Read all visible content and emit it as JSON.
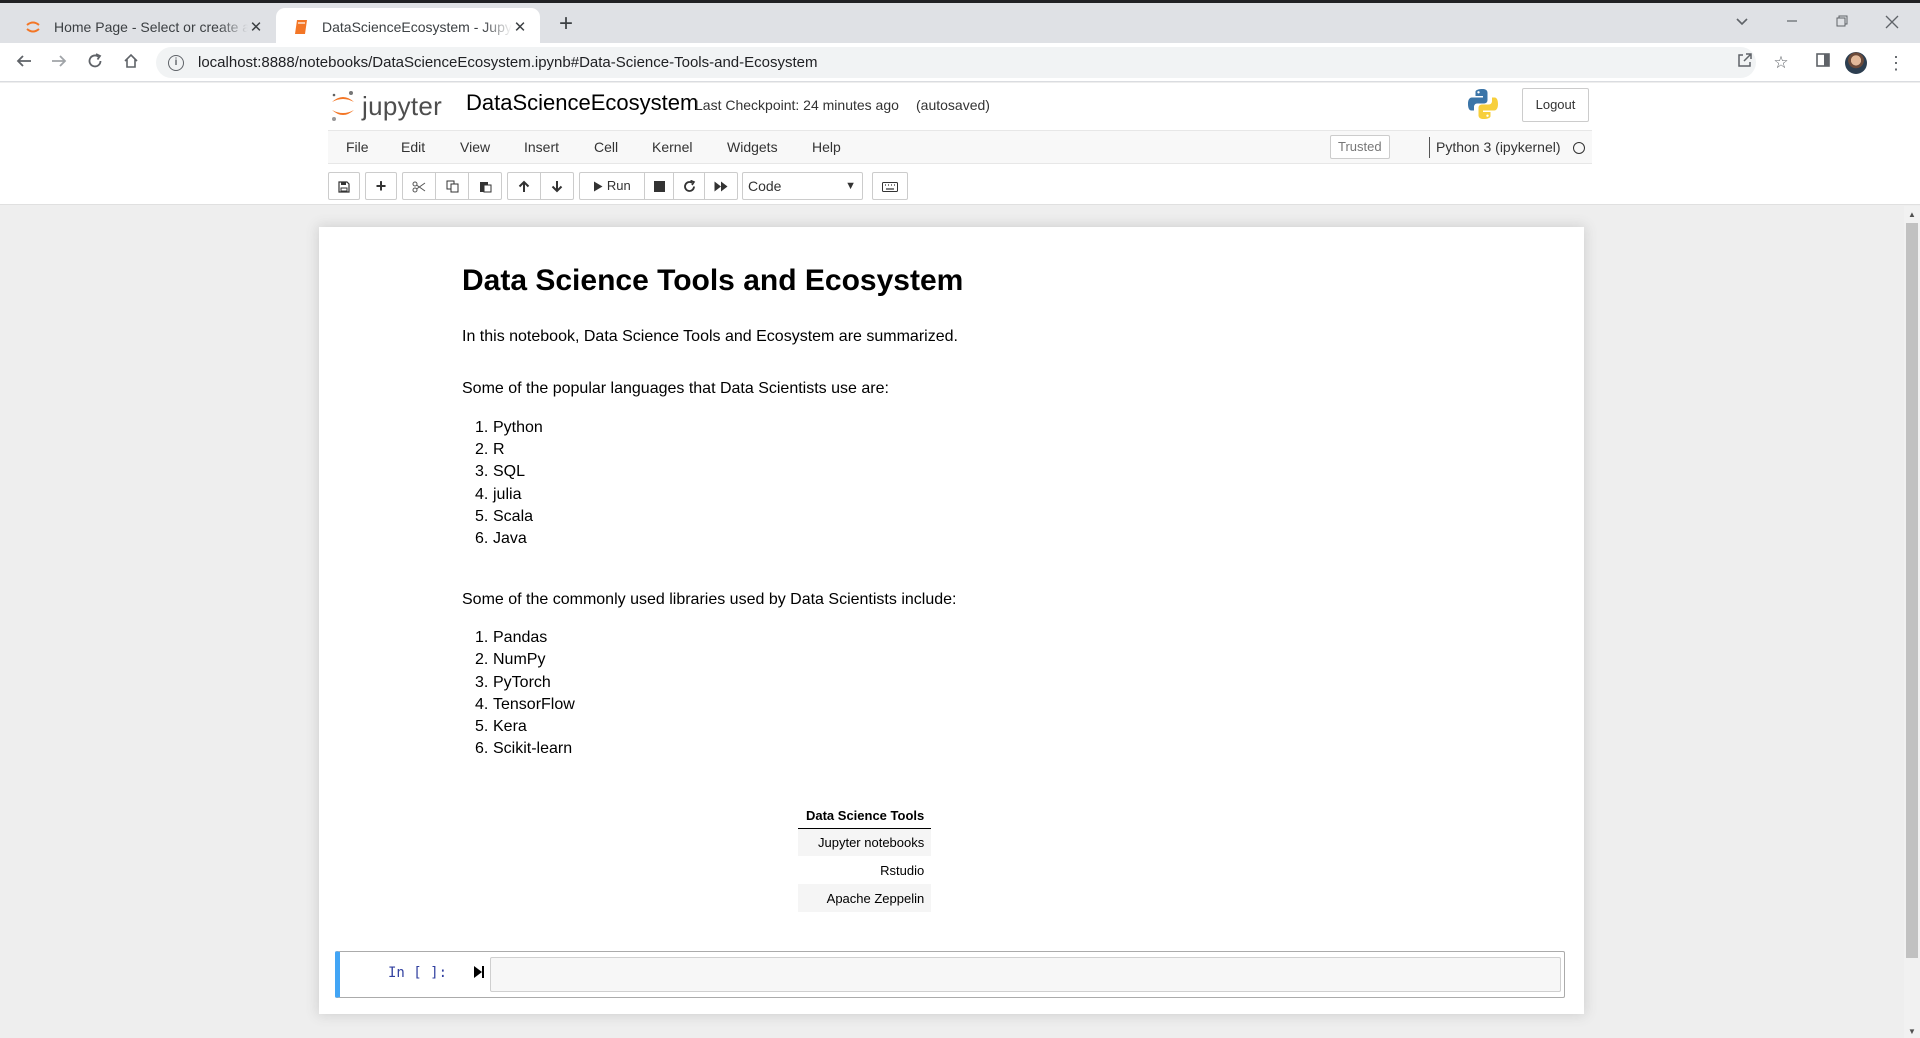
{
  "browser": {
    "tabs": [
      {
        "title": "Home Page - Select or create a notebook",
        "active": false
      },
      {
        "title": "DataScienceEcosystem - Jupyter Notebook",
        "active": true
      }
    ],
    "url": "localhost:8888/notebooks/DataScienceEcosystem.ipynb#Data-Science-Tools-and-Ecosystem",
    "icons": [
      "back-icon",
      "forward-icon",
      "reload-icon",
      "home-icon",
      "info-icon",
      "share-icon",
      "star-icon",
      "side-panel-icon",
      "profile-avatar",
      "menu-icon"
    ]
  },
  "jupyter": {
    "logo_text": "jupyter",
    "notebook_name": "DataScienceEcosystem",
    "checkpoint": "Last Checkpoint: 24 minutes ago",
    "autosave": "(autosaved)",
    "logout_label": "Logout",
    "menu": [
      "File",
      "Edit",
      "View",
      "Insert",
      "Cell",
      "Kernel",
      "Widgets",
      "Help"
    ],
    "trusted_label": "Trusted",
    "kernel_name": "Python 3 (ipykernel)",
    "toolbar": {
      "run_label": "Run",
      "cell_type": "Code"
    },
    "colors": {
      "accent": "#f37626",
      "selected_cell": "#42a5f5",
      "prompt": "#303f9f"
    }
  },
  "notebook": {
    "title": "Data Science Tools and Ecosystem",
    "intro": "In this notebook, Data Science Tools and Ecosystem are summarized.",
    "languages_intro": "Some of the popular languages that Data Scientists use are:",
    "languages": [
      "Python",
      "R",
      "SQL",
      "julia",
      "Scala",
      "Java"
    ],
    "libraries_intro": "Some of the commonly used libraries used by Data Scientists include:",
    "libraries": [
      "Pandas",
      "NumPy",
      "PyTorch",
      "TensorFlow",
      "Kera",
      "Scikit-learn"
    ],
    "table": {
      "header": "Data Science Tools",
      "rows": [
        "Jupyter notebooks",
        "Rstudio",
        "Apache Zeppelin"
      ]
    },
    "code_cell": {
      "prompt": "In [ ]:",
      "source": ""
    }
  }
}
